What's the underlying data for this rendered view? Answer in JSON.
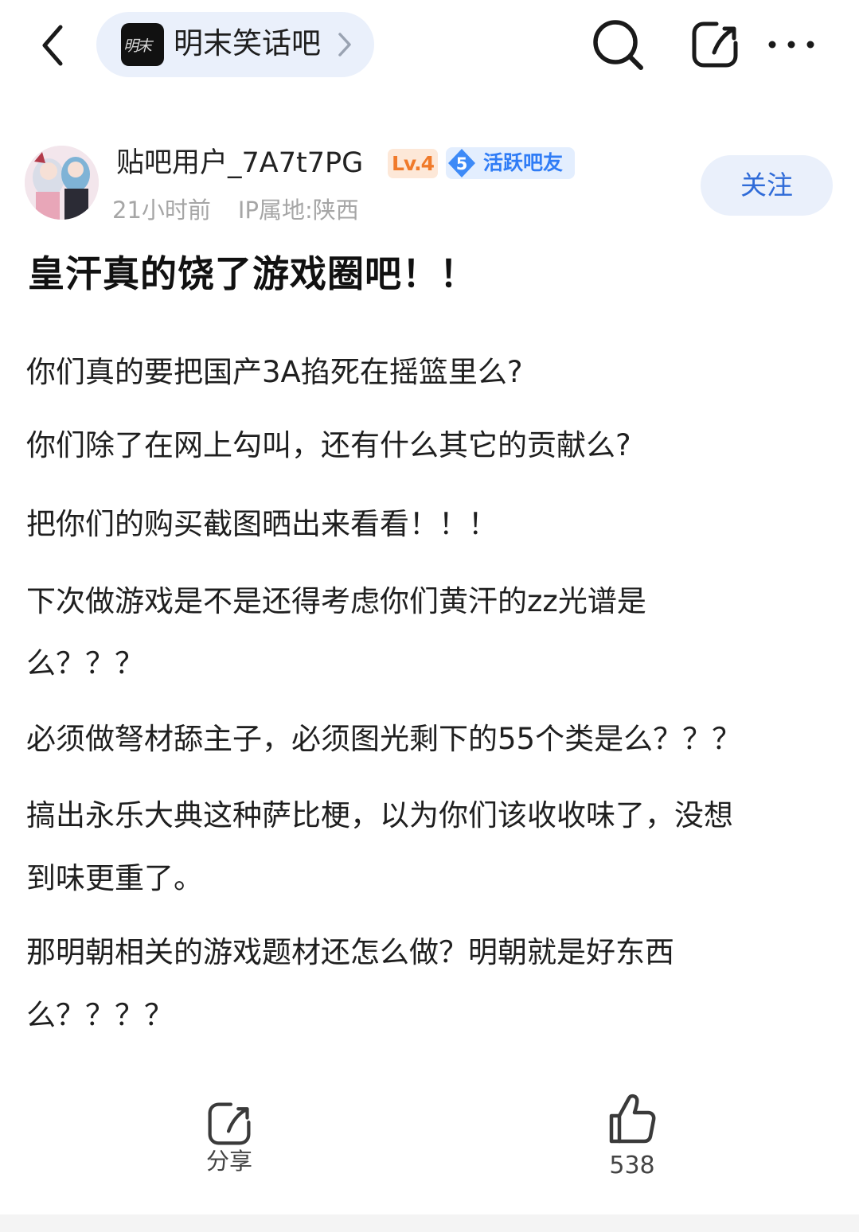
{
  "header": {
    "forum_name": "明末笑话吧",
    "forum_logo_text": "明末",
    "back_icon": "chevron-left-icon",
    "search_icon": "search-icon",
    "share_icon": "share-icon",
    "more_icon": "more-icon"
  },
  "author": {
    "username": "贴吧用户_7A7t7PG",
    "level": "Lv.4",
    "badge_number": "5",
    "badge_label": "活跃吧友",
    "time": "21小时前",
    "ip_location": "IP属地:陕西",
    "follow_label": "关注"
  },
  "post": {
    "title": "皇汗真的饶了游戏圈吧！！",
    "lines": [
      "你们真的要把国产3A掐死在摇篮里么?",
      "你们除了在网上勾叫，还有什么其它的贡献么?",
      "把你们的购买截图晒出来看看！！！",
      "下次做游戏是不是还得考虑你们黄汗的zz光谱是",
      "么？？？",
      "必须做弩材舔主子，必须图光剩下的55个类是么？？？",
      "搞出永乐大典这种萨比梗，以为你们该收收味了，没想",
      "到味更重了。",
      "那明朝相关的游戏题材还怎么做？明朝就是好东西",
      "么？？？？"
    ]
  },
  "actions": {
    "share_label": "分享",
    "like_count": "538"
  },
  "colors": {
    "accent": "#2f6bd8",
    "pill_bg": "#eaf0fb",
    "level_orange": "#f07a2a",
    "meta_gray": "#a6a6a6"
  }
}
